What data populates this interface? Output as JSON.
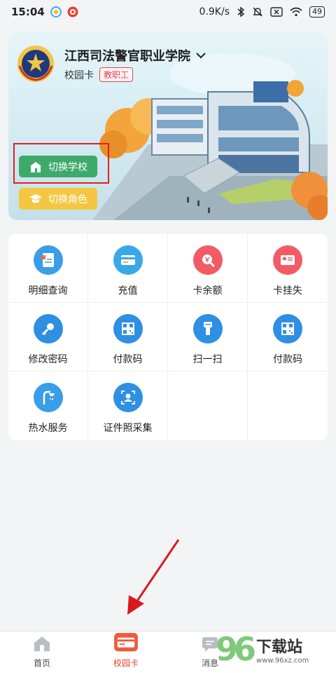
{
  "status_bar": {
    "time": "15:04",
    "net_speed": "0.9K/s",
    "battery": "49"
  },
  "school_card": {
    "school_name": "江西司法警官职业学院",
    "card_label": "校园卡",
    "role_badge": "教职工",
    "switch_school": "切换学校",
    "switch_role": "切换角色"
  },
  "grid": [
    {
      "label": "明细查询",
      "icon": "detail-query-icon",
      "color": "#3a9de8"
    },
    {
      "label": "充值",
      "icon": "recharge-card-icon",
      "color": "#3aa7e8"
    },
    {
      "label": "卡余额",
      "icon": "balance-search-icon",
      "color": "#f25b66"
    },
    {
      "label": "卡挂失",
      "icon": "report-loss-icon",
      "color": "#f25b66"
    },
    {
      "label": "修改密码",
      "icon": "key-icon",
      "color": "#2f8fe3"
    },
    {
      "label": "付款码",
      "icon": "qr-code-icon",
      "color": "#2f8fe3"
    },
    {
      "label": "扫一扫",
      "icon": "scanner-icon",
      "color": "#2f8fe3"
    },
    {
      "label": "付款码",
      "icon": "qr-code-icon",
      "color": "#2f8fe3"
    },
    {
      "label": "热水服务",
      "icon": "shower-icon",
      "color": "#3a9de8"
    },
    {
      "label": "证件照采集",
      "icon": "photo-capture-icon",
      "color": "#2f8fe3"
    }
  ],
  "bottom_nav": [
    {
      "label": "首页",
      "icon": "home-icon"
    },
    {
      "label": "校园卡",
      "icon": "campus-card-icon",
      "active": true
    },
    {
      "label": "消息",
      "icon": "message-icon"
    }
  ],
  "watermark": {
    "digits": "96",
    "title": "下载站",
    "url": "www.96xz.com"
  }
}
